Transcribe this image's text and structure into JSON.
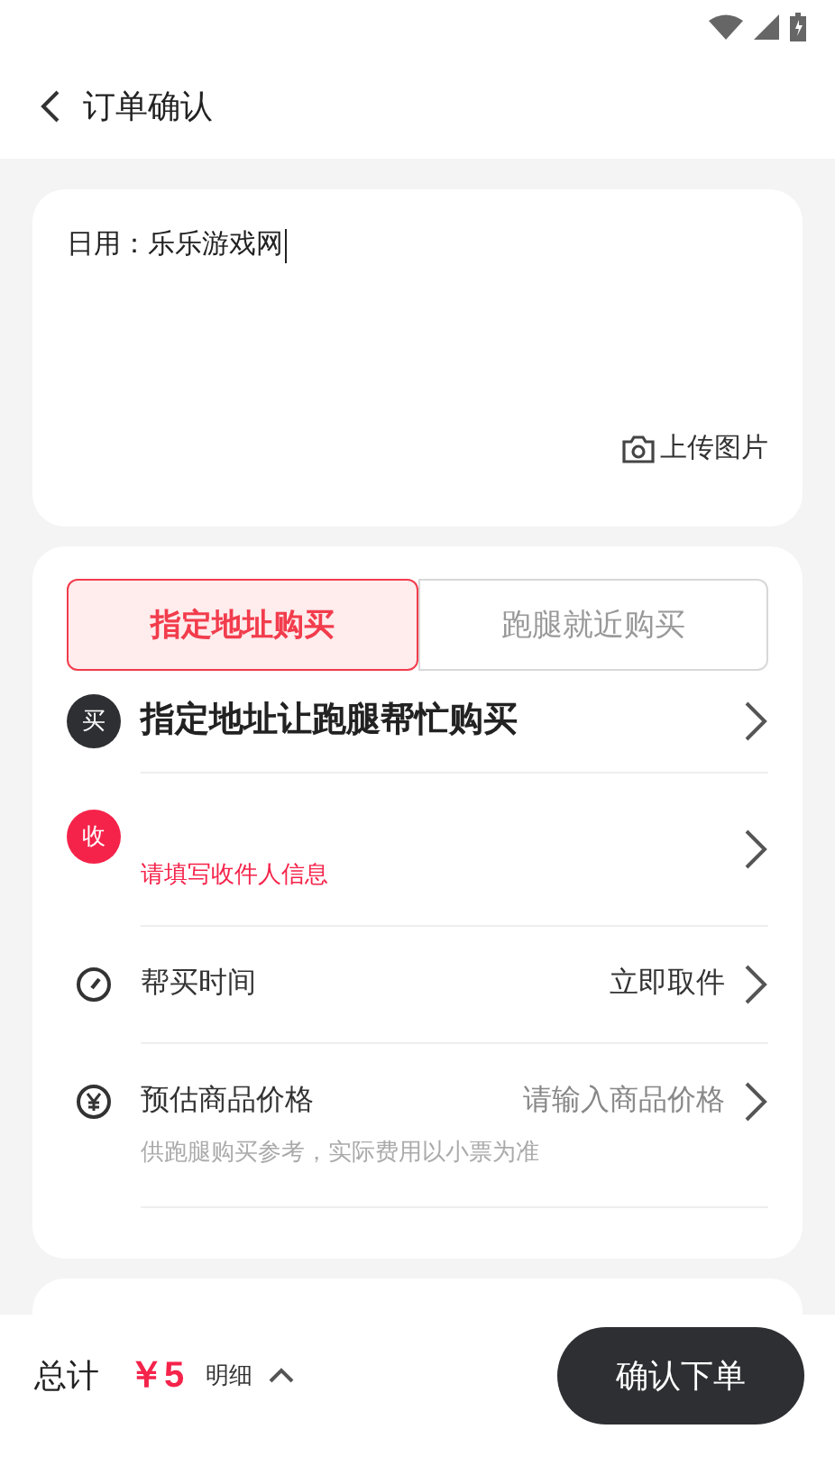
{
  "header": {
    "title": "订单确认"
  },
  "note": {
    "value": "日用：乐乐游戏网",
    "upload": "上传图片"
  },
  "tabs": [
    {
      "label": "指定地址购买",
      "selected": true
    },
    {
      "label": "跑腿就近购买",
      "selected": false
    }
  ],
  "rows": [
    {
      "kind": "title",
      "badge": "买",
      "label": "指定地址让跑腿帮忙购买"
    },
    {
      "kind": "recipient",
      "badge": "收",
      "hint": "请填写收件人信息"
    },
    {
      "kind": "time",
      "label": "帮买时间",
      "value": "立即取件"
    },
    {
      "kind": "price",
      "label": "预估商品价格",
      "placeholder": "请输入商品价格",
      "note": "供跑腿购买参考，实际费用以小票为准"
    }
  ],
  "footer": {
    "total_label": "总计",
    "amount": "￥5",
    "detail": "明细",
    "button": "确认下单"
  }
}
